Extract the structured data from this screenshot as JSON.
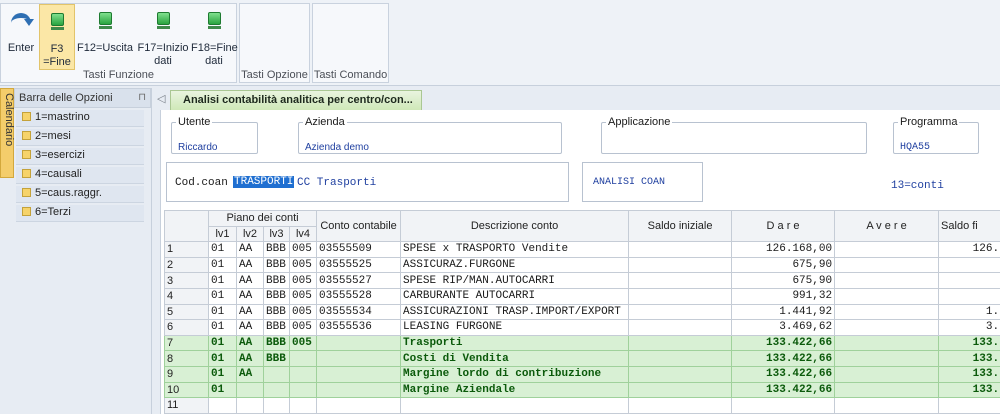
{
  "ribbon": {
    "buttons": [
      {
        "label": "Enter",
        "icon": "enter-arrow-icon"
      },
      {
        "label": "F3\n=Fine",
        "icon": "green-key-icon"
      },
      {
        "label": "F12=Uscita",
        "icon": "green-key-icon"
      },
      {
        "label": "F17=Inizio\ndati",
        "icon": "green-key-icon"
      },
      {
        "label": "F18=Fine\ndati",
        "icon": "green-key-icon"
      }
    ],
    "group_funzioni": "Tasti Funzione",
    "group_opzione": "Tasti Opzione",
    "group_comando": "Tasti Comando"
  },
  "sidebar": {
    "tab_label": "Calendario",
    "header": "Barra delle Opzioni",
    "items": [
      {
        "label": "1=mastrino"
      },
      {
        "label": "2=mesi"
      },
      {
        "label": "3=esercizi"
      },
      {
        "label": "4=causali"
      },
      {
        "label": "5=caus.raggr."
      },
      {
        "label": "6=Terzi"
      }
    ]
  },
  "tab": {
    "title": "Analisi contabilità analitica per centro/con..."
  },
  "form": {
    "utente_label": "Utente",
    "utente_value": "Riccardo",
    "azienda_label": "Azienda",
    "azienda_value": "Azienda demo",
    "applicazione_label": "Applicazione",
    "applicazione_value": "",
    "programma_label": "Programma",
    "programma_value": "HQA55",
    "codcoan_label": "Cod.coan",
    "codcoan_value": "TRASPORTI",
    "codcoan_desc": "CC Trasporti",
    "analisi_label": "ANALISI COAN",
    "conti_label": "13=conti"
  },
  "grid": {
    "group_header": "Piano dei conti",
    "columns": [
      "lv1",
      "lv2",
      "lv3",
      "lv4",
      "Conto contabile",
      "Descrizione conto",
      "Saldo iniziale",
      "D a r e",
      "A v e r e",
      "Saldo fi"
    ],
    "rows": [
      [
        "1",
        "01",
        "AA",
        "BBB",
        "005",
        "03555509",
        "SPESE x TRASPORTO Vendite",
        "",
        "126.168,00",
        "",
        "126."
      ],
      [
        "2",
        "01",
        "AA",
        "BBB",
        "005",
        "03555525",
        "ASSICURAZ.FURGONE",
        "",
        "675,90",
        "",
        ""
      ],
      [
        "3",
        "01",
        "AA",
        "BBB",
        "005",
        "03555527",
        "SPESE RIP/MAN.AUTOCARRI",
        "",
        "675,90",
        "",
        ""
      ],
      [
        "4",
        "01",
        "AA",
        "BBB",
        "005",
        "03555528",
        "CARBURANTE AUTOCARRI",
        "",
        "991,32",
        "",
        ""
      ],
      [
        "5",
        "01",
        "AA",
        "BBB",
        "005",
        "03555534",
        "ASSICURAZIONI TRASP.IMPORT/EXPORT",
        "",
        "1.441,92",
        "",
        "1."
      ],
      [
        "6",
        "01",
        "AA",
        "BBB",
        "005",
        "03555536",
        "LEASING FURGONE",
        "",
        "3.469,62",
        "",
        "3."
      ],
      [
        "7",
        "01",
        "AA",
        "BBB",
        "005",
        "",
        "Trasporti",
        "",
        "133.422,66",
        "",
        "133."
      ],
      [
        "8",
        "01",
        "AA",
        "BBB",
        "",
        "",
        "Costi di Vendita",
        "",
        "133.422,66",
        "",
        "133."
      ],
      [
        "9",
        "01",
        "AA",
        "",
        "",
        "",
        "Margine lordo di contribuzione",
        "",
        "133.422,66",
        "",
        "133."
      ],
      [
        "10",
        "01",
        "",
        "",
        "",
        "",
        "Margine Aziendale",
        "",
        "133.422,66",
        "",
        "133."
      ],
      [
        "11",
        "",
        "",
        "",
        "",
        "",
        "",
        "",
        "",
        "",
        ""
      ]
    ],
    "green_rows": [
      6,
      7,
      8,
      9
    ]
  }
}
